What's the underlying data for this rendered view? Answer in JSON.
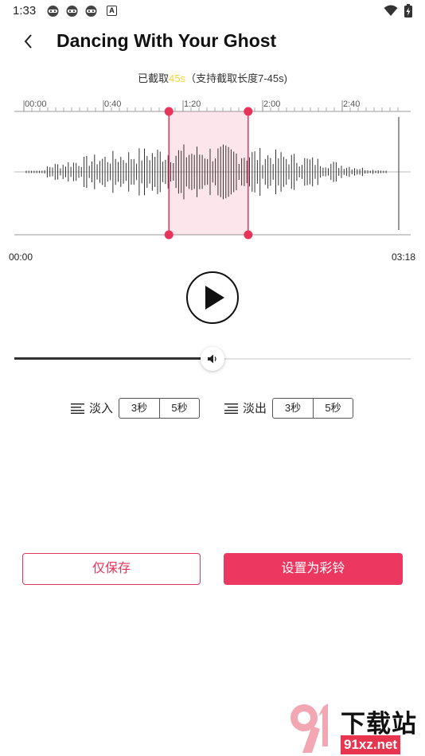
{
  "status_bar": {
    "time": "1:33",
    "left_icons": [
      "app-notification-icon",
      "app-notification-icon",
      "app-notification-icon",
      "a-notification-icon"
    ],
    "a_glyph": "A",
    "right_icons": [
      "wifi-icon",
      "battery-charging-icon"
    ]
  },
  "header": {
    "back_icon": "chevron-left-icon",
    "title": "Dancing With Your Ghost"
  },
  "clip_info": {
    "prefix": "已截取",
    "length": "45s",
    "suffix": "（支持截取长度7-45s)",
    "highlight_color": "#f5d53a"
  },
  "waveform": {
    "ticks": [
      "00:00",
      "0:40",
      "1:20",
      "2:00",
      "2:40"
    ],
    "selection_start_fraction": 0.39,
    "selection_end_fraction": 0.59,
    "selection_color": "#e8335a"
  },
  "time_start": "00:00",
  "time_end": "03:18",
  "player": {
    "play_icon": "play-icon"
  },
  "volume": {
    "icon": "speaker-icon",
    "level_fraction": 0.5
  },
  "fade_in": {
    "icon": "fade-in-icon",
    "label": "淡入",
    "options": [
      "3秒",
      "5秒"
    ]
  },
  "fade_out": {
    "icon": "fade-out-icon",
    "label": "淡出",
    "options": [
      "3秒",
      "5秒"
    ]
  },
  "actions": {
    "save_only": "仅保存",
    "set_ringtone": "设置为彩铃",
    "accent_color": "#ec3760"
  },
  "watermark": {
    "logo_icon": "91-logo-icon",
    "text": "下载站",
    "url": "91xz.net"
  }
}
